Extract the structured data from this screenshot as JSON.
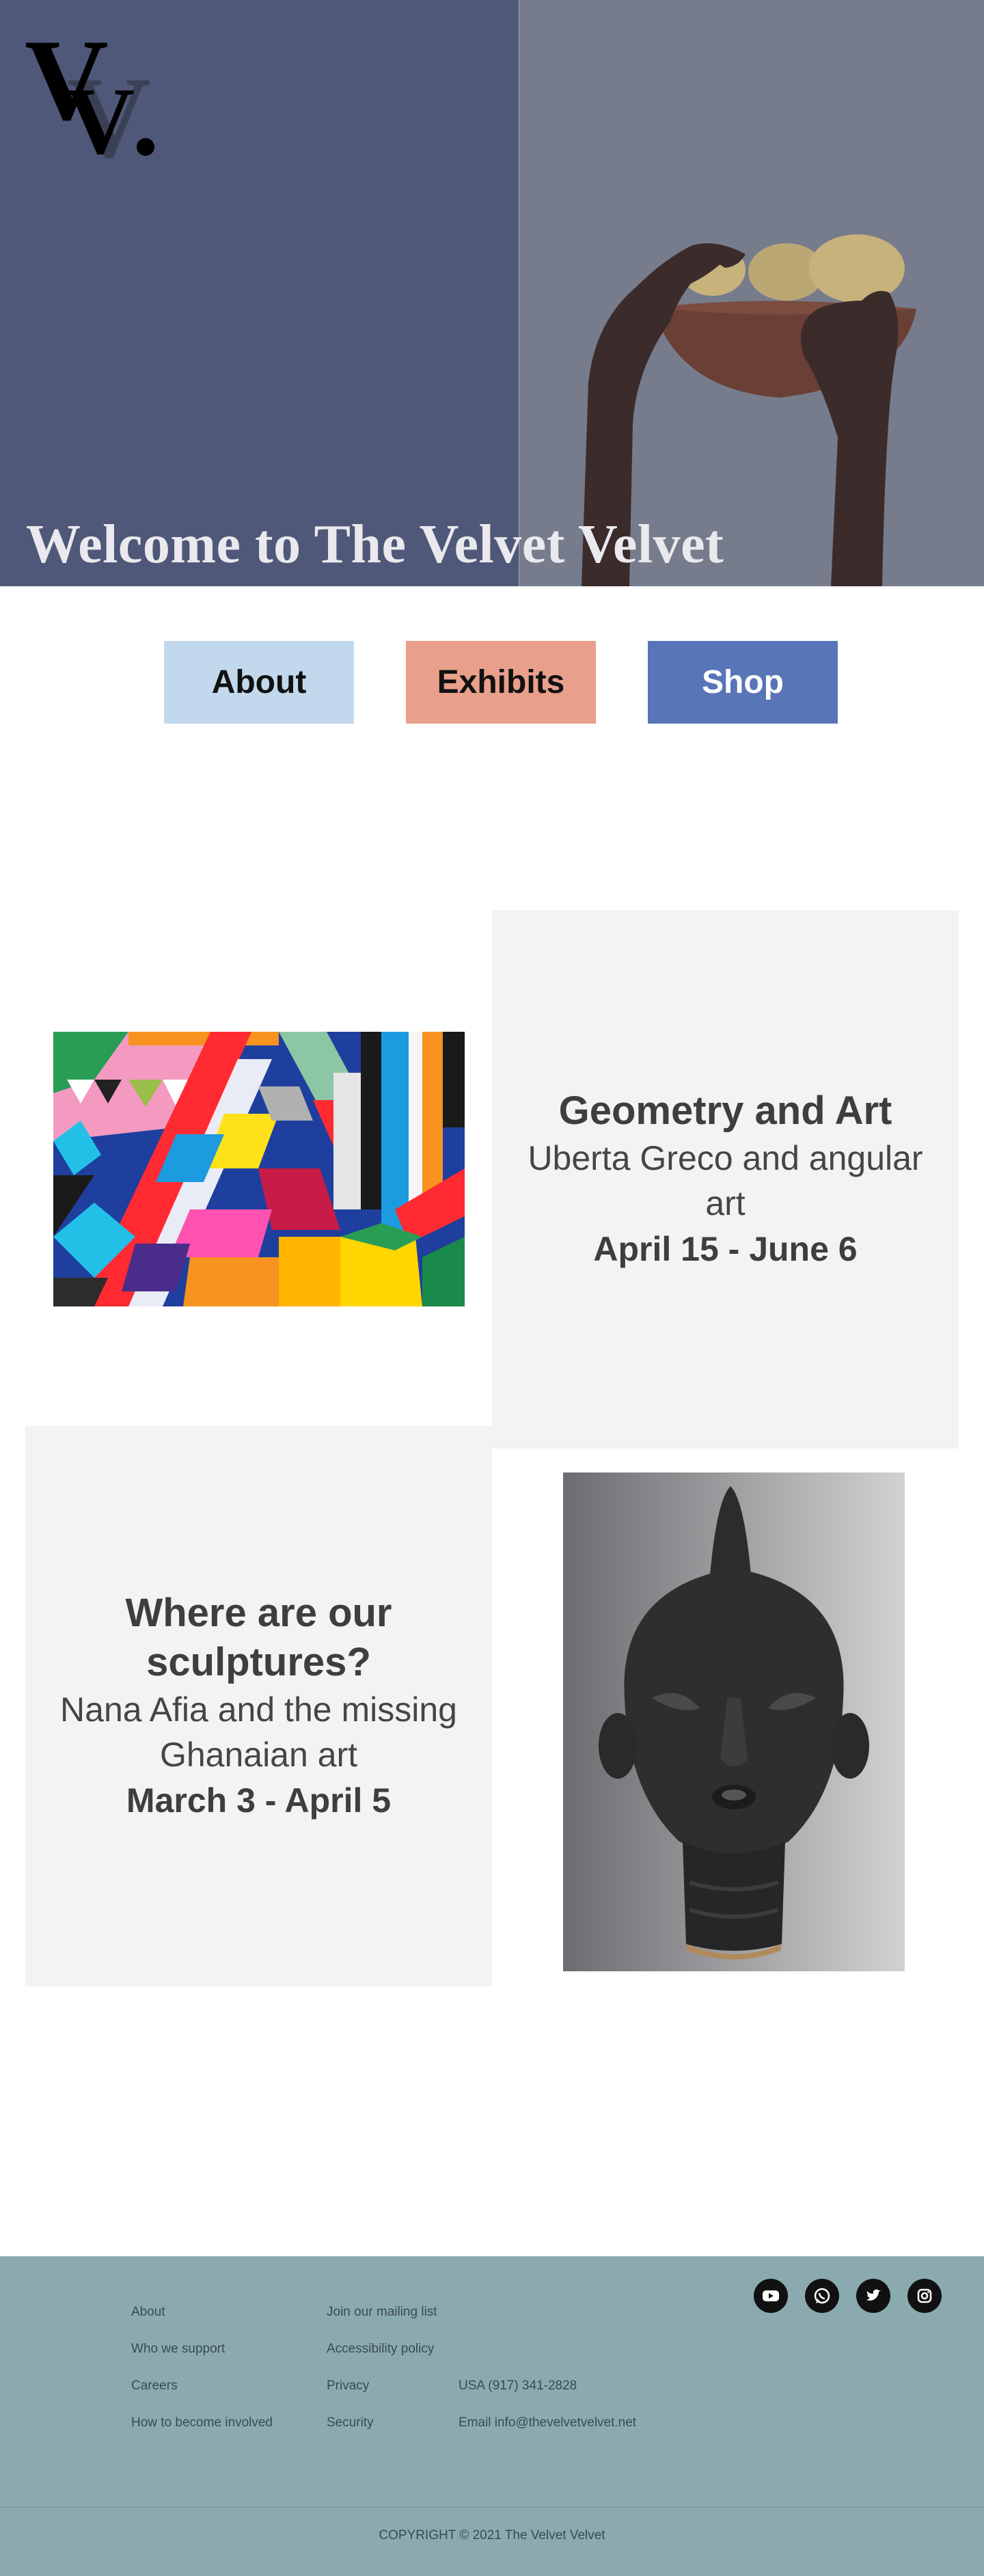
{
  "hero": {
    "title": "Welcome to The Velvet Velvet",
    "logo_icon": "vv-monogram-logo",
    "colors": {
      "left_panel": "#4f5878",
      "right_panel": "#767c8b"
    }
  },
  "nav": {
    "about_label": "About",
    "exhibits_label": "Exhibits",
    "shop_label": "Shop",
    "colors": {
      "about": "#c2d8ed",
      "exhibits": "#e89f8b",
      "shop": "#5775b7"
    }
  },
  "exhibits": [
    {
      "title": "Geometry and Art",
      "subtitle": "Uberta Greco and angular art",
      "dates": "April 15 - June 6",
      "image_icon": "geometric-painting-image"
    },
    {
      "title": "Where are our sculptures?",
      "subtitle": "Nana Afia and the missing Ghanaian art",
      "dates": "March 3 - April 5",
      "image_icon": "ghanaian-sculpture-head-image"
    }
  ],
  "footer": {
    "col1": [
      "About",
      "Who we support",
      "Careers",
      "How to become involved"
    ],
    "col2": [
      "Join our mailing list",
      "Accessibility policy",
      "Privacy",
      "Security"
    ],
    "phone": "USA (917) 341-2828",
    "email": "Email info@thevelvetvelvet.net",
    "social_icons": [
      "youtube-icon",
      "whatsapp-icon",
      "twitter-icon",
      "instagram-icon"
    ],
    "copyright": "COPYRIGHT © 2021 The Velvet Velvet",
    "background": "#8aaab0"
  }
}
